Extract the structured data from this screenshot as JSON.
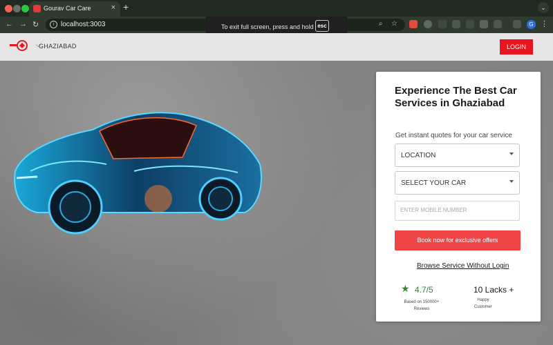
{
  "browser": {
    "tab_title": "Gourav Car Care",
    "tab_close": "×",
    "new_tab": "+",
    "url": "localhost:3003",
    "fullscreen_notice": "To exit full screen, press and hold",
    "fullscreen_key": "esc",
    "profile_initial": "G"
  },
  "header": {
    "city": "GHAZIABAD",
    "login_label": "LOGIN"
  },
  "form": {
    "title": "Experience The Best Car Services in Ghaziabad",
    "subtitle": "Get instant quotes for your car service",
    "location_label": "LOCATION",
    "car_label": "SELECT YOUR CAR",
    "mobile_placeholder": "ENTER MOBILE NUMBER",
    "book_label": "Book now for exclusive offers",
    "browse_label": "Browse Service Without Login"
  },
  "stats": {
    "rating": "4.7/5",
    "rating_sub": "Based on 150000+ Reviews",
    "customers": "10 Lacks +",
    "customers_sub": "Happy Customer"
  },
  "colors": {
    "brand_red": "#e8141e",
    "cta_red": "#f04547",
    "rating_green": "#2a8a2a"
  }
}
